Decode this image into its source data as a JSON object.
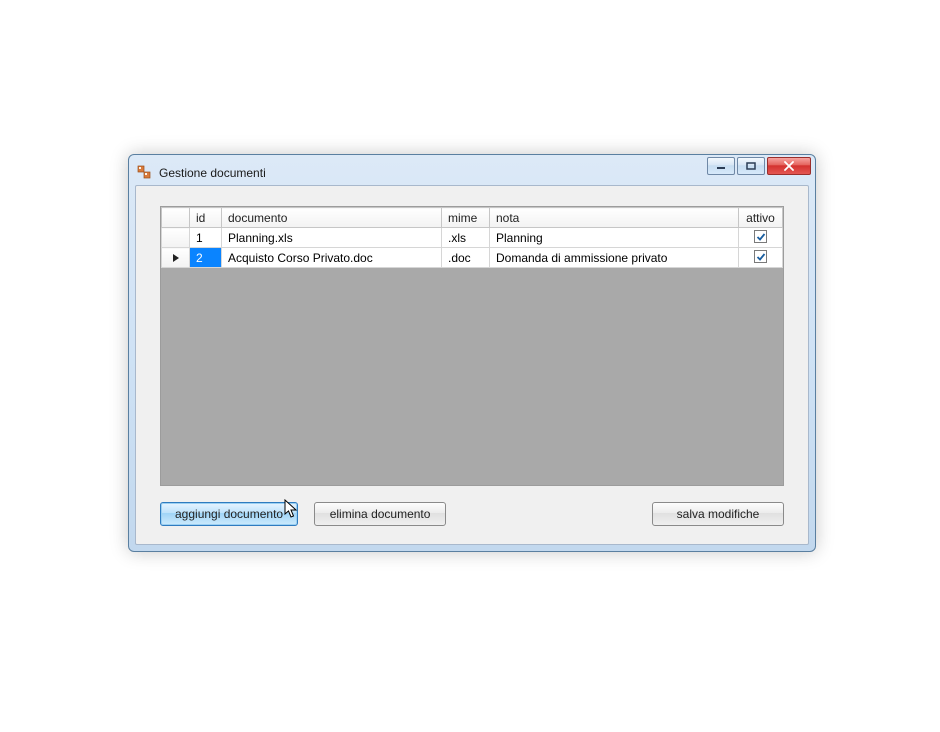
{
  "window": {
    "title": "Gestione documenti"
  },
  "grid": {
    "headers": {
      "id": "id",
      "documento": "documento",
      "mime": "mime",
      "nota": "nota",
      "attivo": "attivo"
    },
    "rows": [
      {
        "id": "1",
        "documento": "Planning.xls",
        "mime": ".xls",
        "nota": "Planning",
        "attivo": true,
        "selected": false
      },
      {
        "id": "2",
        "documento": "Acquisto Corso Privato.doc",
        "mime": ".doc",
        "nota": "Domanda di ammissione privato",
        "attivo": true,
        "selected": true
      }
    ]
  },
  "buttons": {
    "add": "aggiungi documento",
    "delete": "elimina documento",
    "save": "salva modifiche"
  }
}
